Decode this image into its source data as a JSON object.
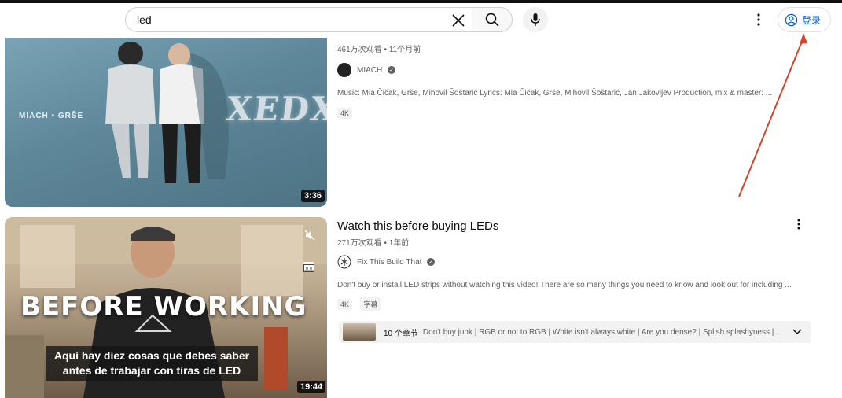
{
  "search": {
    "query": "led"
  },
  "header": {
    "signin_label": "登录"
  },
  "videos": [
    {
      "meta": "461万次观看 • 11个月前",
      "channel": "MIACH",
      "description": "Music: Mia Čičak, Grše, Mihovil Šoštarić Lyrics: Mia Čičak, Grše, Mihovil Šoštarić, Jan Jakovljev Production, mix & master: ...",
      "badges": [
        "4K"
      ],
      "duration": "3:36",
      "thumb_text_brand": "MIACH • GRŠE",
      "thumb_text_title": "XEDX"
    },
    {
      "title": "Watch this before buying LEDs",
      "meta": "271万次观看 • 1年前",
      "channel": "Fix This Build That",
      "description": "Don't buy or install LED strips without watching this video! There are so many things you need to know and look out for including ...",
      "badges": [
        "4K",
        "字幕"
      ],
      "duration": "19:44",
      "thumb_text_big": "BEFORE WORKING",
      "thumb_subtitle_line1": "Aquí hay diez cosas que debes saber",
      "thumb_subtitle_line2": "antes de trabajar con tiras de LED",
      "chapters": {
        "count_label": "10 个章节",
        "text": "Don't buy junk | RGB or not to RGB | White isn't always white | Are you dense? | Splish splashyness |..."
      }
    }
  ],
  "colors": {
    "accent": "#065fd4",
    "annotation_arrow": "#d2462f"
  }
}
